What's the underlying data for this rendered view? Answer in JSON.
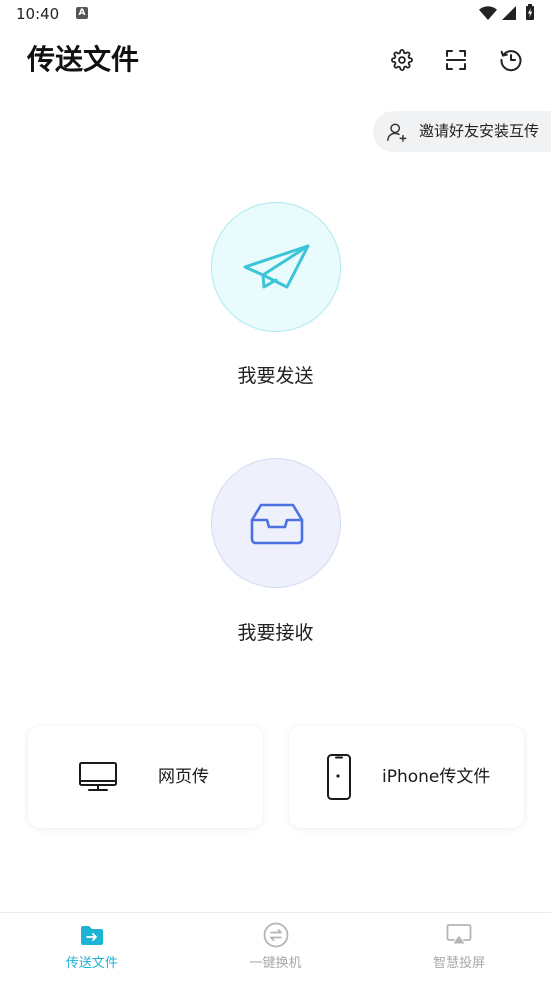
{
  "status_bar": {
    "time": "10:40",
    "notification_glyph": "A",
    "icons": [
      "a-notification-icon",
      "wifi-icon",
      "signal-icon",
      "battery-charging-icon"
    ]
  },
  "header": {
    "title": "传送文件",
    "icons": [
      "gear-icon",
      "scan-icon",
      "history-icon"
    ]
  },
  "invite": {
    "label": "邀请好友安装互传",
    "icon": "person-add-icon"
  },
  "send": {
    "label": "我要发送",
    "icon": "paper-plane-icon"
  },
  "receive": {
    "label": "我要接收",
    "icon": "inbox-icon"
  },
  "cards": [
    {
      "label": "网页传",
      "icon": "monitor-icon"
    },
    {
      "label": "iPhone传文件",
      "icon": "phone-icon"
    }
  ],
  "bottom_nav": {
    "items": [
      {
        "label": "传送文件",
        "icon": "folder-transfer-icon",
        "active": true
      },
      {
        "label": "一键换机",
        "icon": "swap-circle-icon",
        "active": false
      },
      {
        "label": "智慧投屏",
        "icon": "screen-cast-icon",
        "active": false
      }
    ]
  },
  "colors": {
    "accent": "#1db3d4",
    "send_fill": "#eafbfd",
    "send_border": "#a9e9ef",
    "send_icon": "#3cc4d7",
    "receive_fill": "#eef1fc",
    "receive_border": "#d3d9f3",
    "receive_icon": "#4c72e2",
    "inactive": "#a8a8a8",
    "pill_bg": "#f1f2f4"
  }
}
